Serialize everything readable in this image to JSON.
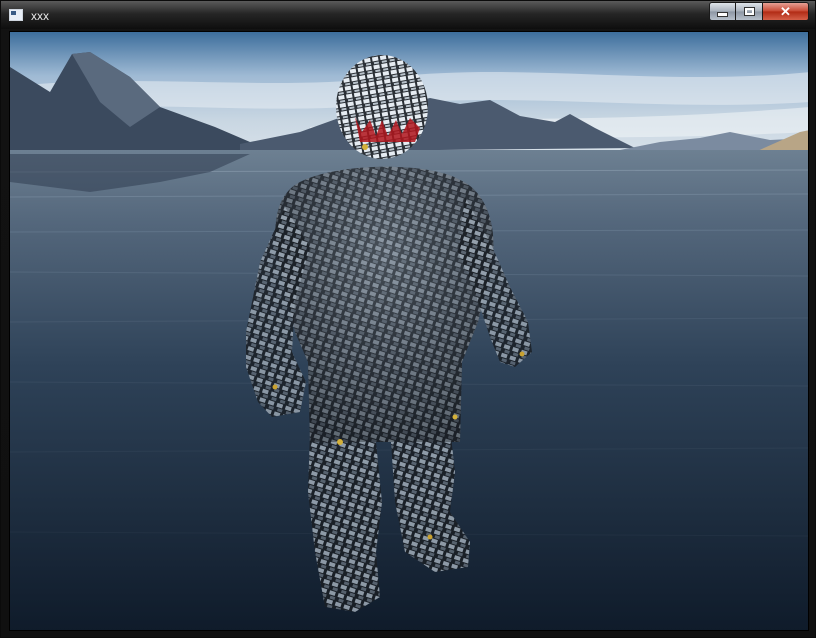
{
  "window": {
    "title": "xxx",
    "close_glyph": "✕"
  },
  "scene": {
    "sky_color": "#7fa3c6",
    "water_color": "#1a2a3d",
    "model_color": "#8f9aa6",
    "accent_color": "#b0151c"
  }
}
